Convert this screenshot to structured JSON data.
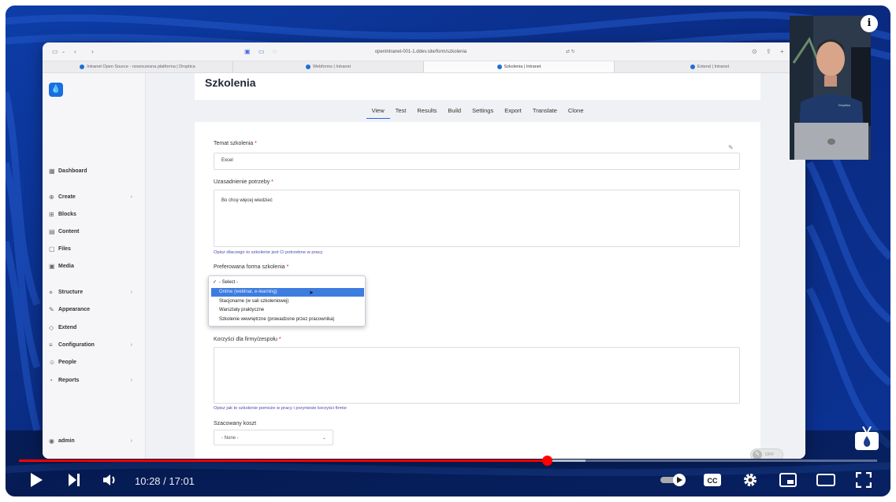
{
  "browser": {
    "url": "openintranet-001-1.ddev.site/form/szkolenia",
    "tabs": [
      {
        "label": "Intranet Open Source - nowoczesna platforma | Droptica",
        "active": false
      },
      {
        "label": "Webforms | Intranet",
        "active": false
      },
      {
        "label": "Szkolenia | Intranet",
        "active": true
      },
      {
        "label": "Extend | Intranet",
        "active": false
      }
    ]
  },
  "sidebar": {
    "items": [
      {
        "label": "Dashboard",
        "icon": "dashboard-icon",
        "glyph": "▦",
        "chevron": false
      },
      {
        "label": "Create",
        "icon": "plus-circle-icon",
        "glyph": "⊕",
        "chevron": true
      },
      {
        "label": "Blocks",
        "icon": "blocks-icon",
        "glyph": "⊞",
        "chevron": false
      },
      {
        "label": "Content",
        "icon": "content-icon",
        "glyph": "▤",
        "chevron": false
      },
      {
        "label": "Files",
        "icon": "file-icon",
        "glyph": "▢",
        "chevron": false
      },
      {
        "label": "Media",
        "icon": "media-icon",
        "glyph": "▣",
        "chevron": false
      },
      {
        "label": "Structure",
        "icon": "structure-icon",
        "glyph": "⋄",
        "chevron": true
      },
      {
        "label": "Appearance",
        "icon": "brush-icon",
        "glyph": "✎",
        "chevron": false
      },
      {
        "label": "Extend",
        "icon": "puzzle-icon",
        "glyph": "◇",
        "chevron": false
      },
      {
        "label": "Configuration",
        "icon": "sliders-icon",
        "glyph": "≡",
        "chevron": true
      },
      {
        "label": "People",
        "icon": "people-icon",
        "glyph": "☺",
        "chevron": false
      },
      {
        "label": "Reports",
        "icon": "reports-icon",
        "glyph": "◔",
        "chevron": true
      }
    ],
    "user": {
      "label": "admin",
      "icon": "user-icon"
    }
  },
  "page": {
    "title": "Szkolenia",
    "local_tabs": [
      "View",
      "Test",
      "Results",
      "Build",
      "Settings",
      "Export",
      "Translate",
      "Clone"
    ],
    "active_tab": "View"
  },
  "form": {
    "topic": {
      "label": "Temat szkolenia",
      "value": "Excel"
    },
    "justification": {
      "label": "Uzasadnienie potrzeby",
      "value": "Bo chcę więcej wiedzieć",
      "help": "Opisz dlaczego to szkolenie jest Ci potrzebne w pracy"
    },
    "format": {
      "label": "Preferowana forma szkolenia",
      "options": [
        "- Select -",
        "Online (webinar, e-learning)",
        "Stacjonarne (w sali szkoleniowej)",
        "Warsztaty praktyczne",
        "Szkolenie wewnętrzne (prowadzone przez pracownika)"
      ],
      "checked_index": 0,
      "highlighted_index": 1
    },
    "benefits": {
      "label": "Korzyści dla firmy/zespołu",
      "value": "",
      "help": "Opisz jak to szkolenie pomoże w pracy i przyniesie korzyści firmie"
    },
    "cost": {
      "label": "Szacowany koszt",
      "value": "- None -"
    },
    "toggle": {
      "label": "OFF"
    }
  },
  "player": {
    "time": "10:28 / 17:01",
    "progress_fraction": 0.6152,
    "buffered_fraction": 0.66
  },
  "colors": {
    "accent": "#2563eb",
    "progress": "#ff0000",
    "highlight": "#3d7de0",
    "background": "#0c2f8a"
  }
}
